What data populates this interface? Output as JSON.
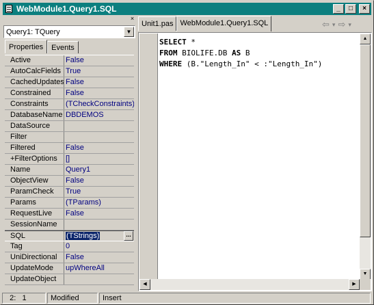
{
  "window": {
    "title": "WebModule1.Query1.SQL"
  },
  "title_buttons": {
    "minimize": "_",
    "maximize": "□",
    "close": "×"
  },
  "inspector": {
    "object_selector": "Query1: TQuery",
    "tabs": [
      "Properties",
      "Events"
    ],
    "properties": [
      {
        "name": "Active",
        "value": "False"
      },
      {
        "name": "AutoCalcFields",
        "value": "True"
      },
      {
        "name": "CachedUpdates",
        "value": "False"
      },
      {
        "name": "Constrained",
        "value": "False"
      },
      {
        "name": "Constraints",
        "value": "(TCheckConstraints)"
      },
      {
        "name": "DatabaseName",
        "value": "DBDEMOS"
      },
      {
        "name": "DataSource",
        "value": ""
      },
      {
        "name": "Filter",
        "value": ""
      },
      {
        "name": "Filtered",
        "value": "False"
      },
      {
        "name": "+FilterOptions",
        "value": "[]"
      },
      {
        "name": "Name",
        "value": "Query1"
      },
      {
        "name": "ObjectView",
        "value": "False"
      },
      {
        "name": "ParamCheck",
        "value": "True"
      },
      {
        "name": "Params",
        "value": "(TParams)"
      },
      {
        "name": "RequestLive",
        "value": "False"
      },
      {
        "name": "SessionName",
        "value": ""
      },
      {
        "name": "SQL",
        "value": "(TStrings)",
        "selected": true
      },
      {
        "name": "Tag",
        "value": "0"
      },
      {
        "name": "UniDirectional",
        "value": "False"
      },
      {
        "name": "UpdateMode",
        "value": "upWhereAll"
      },
      {
        "name": "UpdateObject",
        "value": ""
      }
    ]
  },
  "editor": {
    "tabs": [
      "Unit1.pas",
      "WebModule1.Query1.SQL"
    ],
    "active_tab": 1,
    "nav": {
      "back": "⇦",
      "back_dd": "▾",
      "forward": "⇨",
      "forward_dd": "▾"
    },
    "code": {
      "l1_kw": "SELECT",
      "l1_rest": " *",
      "l2_kw": "FROM",
      "l2_mid": " BIOLIFE.DB ",
      "l2_kw2": "AS",
      "l2_rest": " B",
      "l3_kw": "WHERE",
      "l3_rest": " (B.\"Length_In\" < :\"Length_In\")"
    }
  },
  "status": {
    "position": "  2:   1",
    "modified": "Modified",
    "mode": "Insert"
  }
}
